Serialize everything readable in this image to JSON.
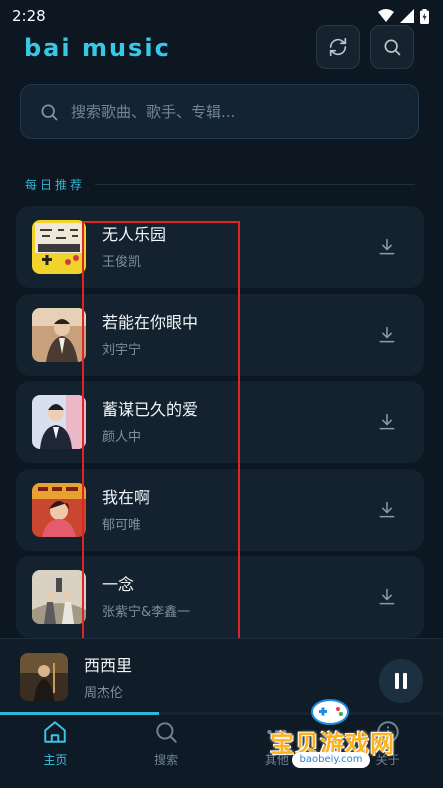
{
  "status_bar": {
    "time": "2:28"
  },
  "header": {
    "app_title": "bai music"
  },
  "search": {
    "placeholder": "搜索歌曲、歌手、专辑..."
  },
  "section": {
    "title": "每日推荐"
  },
  "songs": [
    {
      "title": "无人乐园",
      "artist": "王俊凯"
    },
    {
      "title": "若能在你眼中",
      "artist": "刘宇宁"
    },
    {
      "title": "蓄谋已久的爱",
      "artist": "颜人中"
    },
    {
      "title": "我在啊",
      "artist": "郁可唯"
    },
    {
      "title": "一念",
      "artist": "张紫宁&李鑫一"
    }
  ],
  "now_playing": {
    "title": "西西里",
    "artist": "周杰伦",
    "progress": 0.36
  },
  "tabs": [
    {
      "label": "主页",
      "icon": "home-icon",
      "active": true
    },
    {
      "label": "搜索",
      "icon": "search-icon",
      "active": false
    },
    {
      "label": "其他",
      "icon": "more-icon",
      "active": false
    },
    {
      "label": "关于",
      "icon": "info-icon",
      "active": false
    }
  ],
  "watermark": {
    "text": "宝贝游戏网",
    "url": "baobeiy.com"
  },
  "colors": {
    "accent": "#2fb6d3",
    "background": "#0c1722",
    "card": "#142230",
    "highlight": "#e02424"
  }
}
